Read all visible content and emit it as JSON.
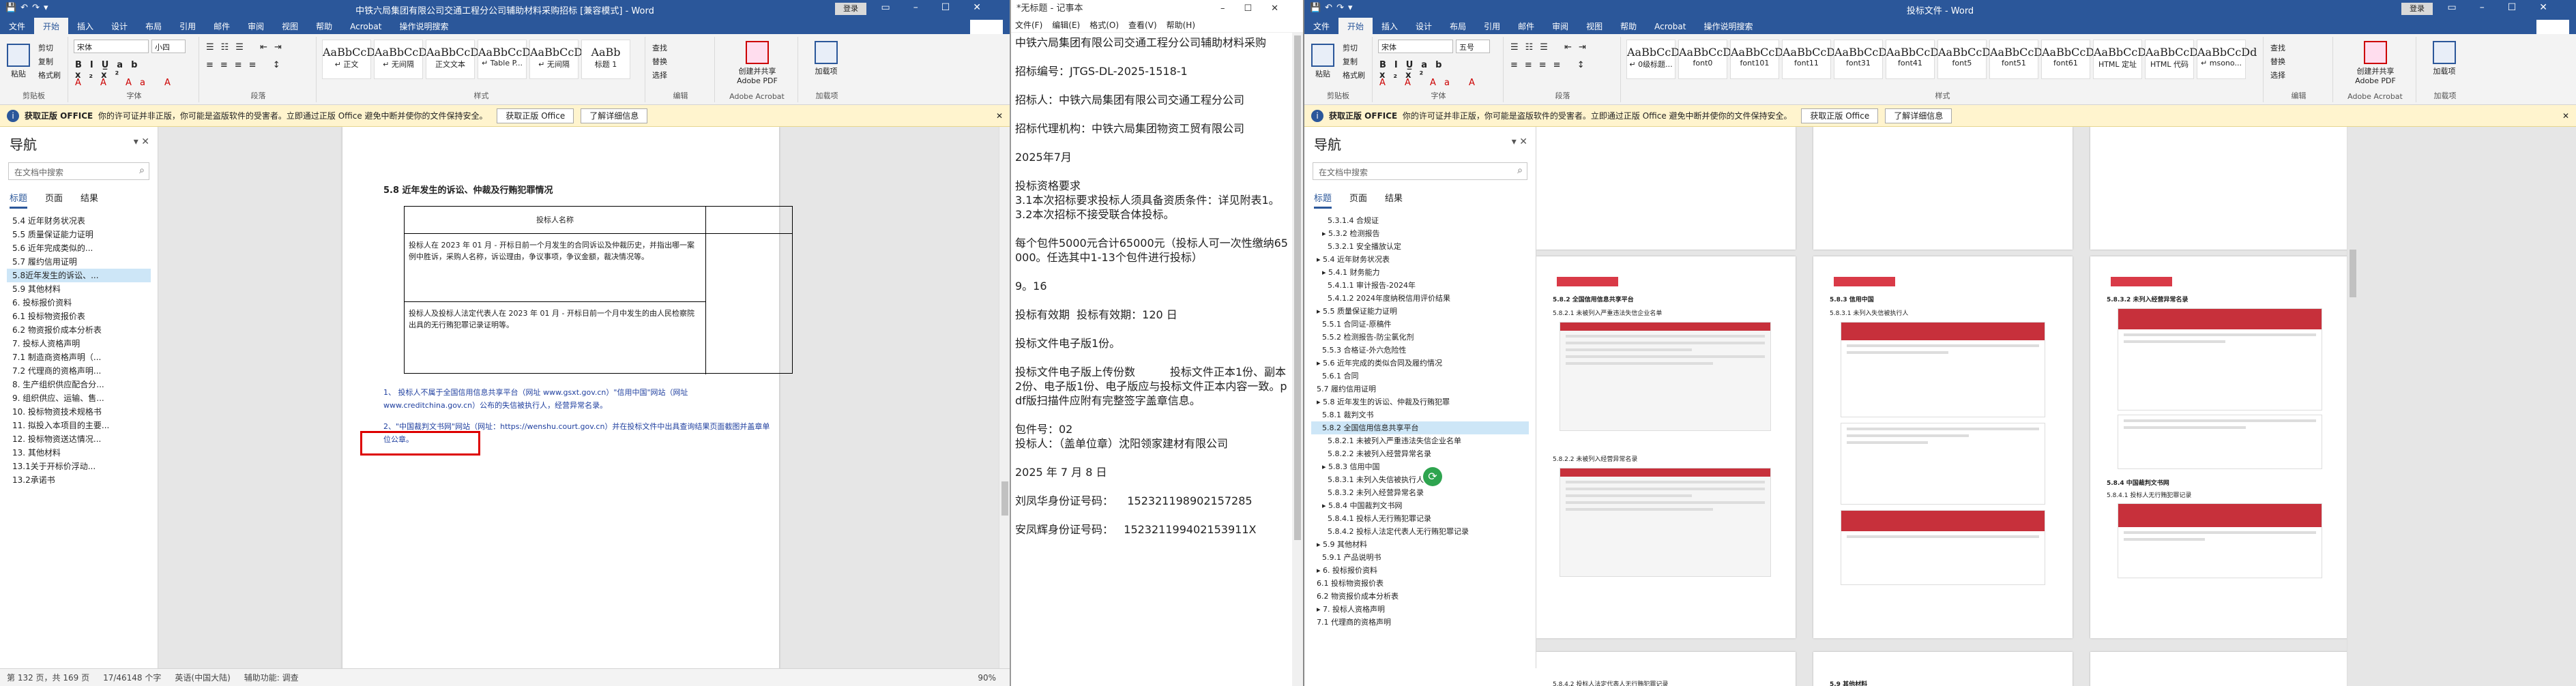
{
  "word1": {
    "title": "中铁六局集团有限公司交通工程分公司辅助材料采购招标 [兼容模式] - Word",
    "login": "登录",
    "share": "共享",
    "tabs": [
      "文件",
      "开始",
      "插入",
      "设计",
      "布局",
      "引用",
      "邮件",
      "审阅",
      "视图",
      "帮助",
      "Acrobat",
      "操作说明搜索"
    ],
    "clipboard": {
      "paste": "粘贴",
      "cut": "剪切",
      "copy": "复制",
      "painter": "格式刷",
      "caption": "剪贴板"
    },
    "font": {
      "name": "宋体",
      "size": "小四",
      "caption": "字体"
    },
    "paragraph_caption": "段落",
    "styles": [
      {
        "preview": "AaBbCcDc",
        "label": "↵ 正文"
      },
      {
        "preview": "AaBbCcDc",
        "label": "↵ 无间隔"
      },
      {
        "preview": "AaBbCcDc",
        "label": "正文文本"
      },
      {
        "preview": "AaBbCcDc",
        "label": "↵ Table P..."
      },
      {
        "preview": "AaBbCcDc",
        "label": "↵ 无间隔"
      },
      {
        "preview": "AaBb",
        "label": "标题 1"
      }
    ],
    "styles_caption": "样式",
    "edit": {
      "find": "查找",
      "replace": "替换",
      "select": "选择",
      "caption": "编辑"
    },
    "pdf": {
      "label": "创建并共享 Adobe PDF",
      "caption": "Adobe Acrobat"
    },
    "addins": {
      "label": "加载项",
      "caption": "加载项"
    },
    "warning": {
      "brand": "获取正版 OFFICE",
      "text": "你的许可证并非正版，你可能是盗版软件的受害者。立即通过正版 Office 避免中断并使你的文件保持安全。",
      "btn1": "获取正版 Office",
      "btn2": "了解详细信息"
    },
    "nav": {
      "title": "导航",
      "search": "在文档中搜索",
      "tabs": [
        "标题",
        "页面",
        "结果"
      ],
      "items": [
        "5.4 近年财务状况表",
        "5.5 质量保证能力证明",
        "5.6 近年完成类似的...",
        "5.7 履约信用证明",
        "5.8近年发生的诉讼、...",
        "5.9 其他材料",
        "6. 投标报价资料",
        "6.1 投标物资报价表",
        "6.2 物资报价成本分析表",
        "7. 投标人资格声明",
        "7.1 制造商资格声明（...",
        "7.2 代理商的资格声明...",
        "8. 生产组织供应配合分...",
        "9. 组织供应、运输、售...",
        "10. 投标物资技术规格书",
        "11. 拟投入本项目的主要...",
        "12. 投标物资送达情况...",
        "13. 其他材料",
        "13.1关于开标价浮动...",
        "13.2承诺书"
      ]
    },
    "doc": {
      "heading": "5.8 近年发生的诉讼、仲裁及行贿犯罪情况",
      "table": {
        "col1": "投标人名称",
        "r2": "投标人在 2023 年 01 月 - 开标日前一个月发生的合同诉讼及仲裁历史，并指出哪一案例中胜诉，采购人名称，诉讼理由，争议事项，争议金额，裁决情况等。",
        "r3": "投标人及投标人法定代表人在 2023 年 01 月 - 开标日前一个月中发生的由人民检察院出具的无行贿犯罪记录证明等。"
      },
      "p1": "1、 投标人不属于全国信用信息共享平台（网址 www.gsxt.gov.cn）\"信用中国\"网站（网址 www.creditchina.gov.cn）公布的失信被执行人，经营异常名录。",
      "p2": "2、\"中国裁判文书网\"网站（网址：https://wenshu.court.gov.cn）并在投标文件中出具查询结果页面截图并盖章单位公章。"
    },
    "status": {
      "page": "第 132 页，共 169 页",
      "words": "17/46148 个字",
      "lang": "英语(中国大陆)",
      "acc": "辅助功能: 调查",
      "zoom": "90%"
    }
  },
  "notepad": {
    "title": "*无标题 - 记事本",
    "menu": [
      "文件(F)",
      "编辑(E)",
      "格式(O)",
      "查看(V)",
      "帮助(H)"
    ],
    "lines": [
      "中铁六局集团有限公司交通工程分公司辅助材料采购",
      "",
      "招标编号：JTGS-DL-2025-1518-1",
      "",
      "招标人：中铁六局集团有限公司交通工程分公司",
      "",
      "招标代理机构：中铁六局集团物资工贸有限公司",
      "",
      "2025年7月",
      "",
      "投标资格要求",
      "3.1本次招标要求投标人须具备资质条件：详见附表1。",
      "3.2本次招标不接受联合体投标。",
      "",
      "每个包件5000元合计65000元（投标人可一次性缴纳65000。任选其中1-13个包件进行投标）",
      "",
      "9。16",
      "",
      "投标有效期  投标有效期：120 日",
      "",
      "投标文件电子版1份。",
      "",
      "投标文件电子版上传份数          投标文件正本1份、副本2份、电子版1份、电子版应与投标文件正本内容一致。pdf版扫描件应附有完整签字盖章信息。",
      "",
      "包件号：02",
      "投标人：（盖单位章）沈阳领家建材有限公司",
      "",
      "2025 年 7 月 8 日",
      "",
      "刘凤华身份证号码：    152321198902157285",
      "",
      "安凤辉身份证号码：   152321199402153911X"
    ]
  },
  "word2": {
    "title": "投标文件 - Word",
    "login": "登录",
    "share": "共享",
    "tabs": [
      "文件",
      "开始",
      "插入",
      "设计",
      "布局",
      "引用",
      "邮件",
      "审阅",
      "视图",
      "帮助",
      "Acrobat",
      "操作说明搜索"
    ],
    "font": {
      "name": "宋体",
      "size": "五号"
    },
    "styles": [
      {
        "preview": "AaBbCcDd",
        "label": "↵ 0级标题..."
      },
      {
        "preview": "AaBbCcDd",
        "label": "font0"
      },
      {
        "preview": "AaBbCcDd",
        "label": "font101"
      },
      {
        "preview": "AaBbCcDd",
        "label": "font11"
      },
      {
        "preview": "AaBbCcDd",
        "label": "font31"
      },
      {
        "preview": "AaBbCcDd",
        "label": "font41"
      },
      {
        "preview": "AaBbCcDd",
        "label": "font5"
      },
      {
        "preview": "AaBbCcDd",
        "label": "font51"
      },
      {
        "preview": "AaBbCcDd",
        "label": "font61"
      },
      {
        "preview": "AaBbCcDd",
        "label": "HTML 定址"
      },
      {
        "preview": "AaBbCcDd",
        "label": "HTML 代码"
      },
      {
        "preview": "AaBbCcDd",
        "label": "↵ msono..."
      }
    ],
    "warning": {
      "brand": "获取正版 OFFICE",
      "text": "你的许可证并非正版，你可能是盗版软件的受害者。立即通过正版 Office 避免中断并使你的文件保持安全。",
      "btn1": "获取正版 Office",
      "btn2": "了解详细信息"
    },
    "nav": {
      "title": "导航",
      "search": "在文档中搜索",
      "tabs": [
        "标题",
        "页面",
        "结果"
      ],
      "items": [
        "5.3.1.4 合规证",
        "▸ 5.3.2 检测报告",
        "5.3.2.1 安全播放认定",
        "▸ 5.4 近年财务状况表",
        "▸ 5.4.1 财务能力",
        "5.4.1.1 审计报告-2024年",
        "5.4.1.2 2024年度纳税信用评价结果",
        "▸ 5.5 质量保证能力证明",
        "5.5.1 合同证-原稿件",
        "5.5.2 检测报告-防尘氯化剂",
        "5.5.3 合格证-外六危险性",
        "▸ 5.6 近年完成的类似合同及履约情况",
        "5.6.1 合同",
        "5.7 履约信用证明",
        "▸ 5.8 近年发生的诉讼、仲裁及行贿犯罪",
        "5.8.1 裁判文书",
        "5.8.2 全国信用信息共享平台",
        "5.8.2.1 未被列入严重违法失信企业名单",
        "5.8.2.2 未被列入经营异常名录",
        "▸ 5.8.3 信用中国",
        "5.8.3.1 未列入失信被执行人",
        "5.8.3.2 未列入经营异常名录",
        "▸ 5.8.4 中国裁判文书网",
        "5.8.4.1 投标人无行贿犯罪记录",
        "5.8.4.2 投标人法定代表人无行贿犯罪记录",
        "▸ 5.9 其他材料",
        "5.9.1 产品说明书",
        "▸ 6. 投标报价资料",
        "6.1 投标物资报价表",
        "6.2 物资报价成本分析表",
        "▸ 7. 投标人资格声明",
        "7.1 代理商的资格声明"
      ]
    },
    "pages": {
      "h1": "5.8.2 全国信用信息共享平台",
      "h1a": "5.8.2.1 未被列入严重违法失信企业名单",
      "h2": "5.8.3 信用中国",
      "h2a": "5.8.3.1 未列入失信被执行人",
      "h3": "5.8.3.2 未列入经营异常名录",
      "h4": "5.8.4 中国裁判文书网",
      "h4a": "5.8.4.1 投标人无行贿犯罪记录",
      "h5": "5.8.2.2 未被列入经营异常名录",
      "h6": "5.8.4.2 投标人法定代表人无行贿犯罪记录",
      "h7": "5.9 其他材料"
    }
  }
}
